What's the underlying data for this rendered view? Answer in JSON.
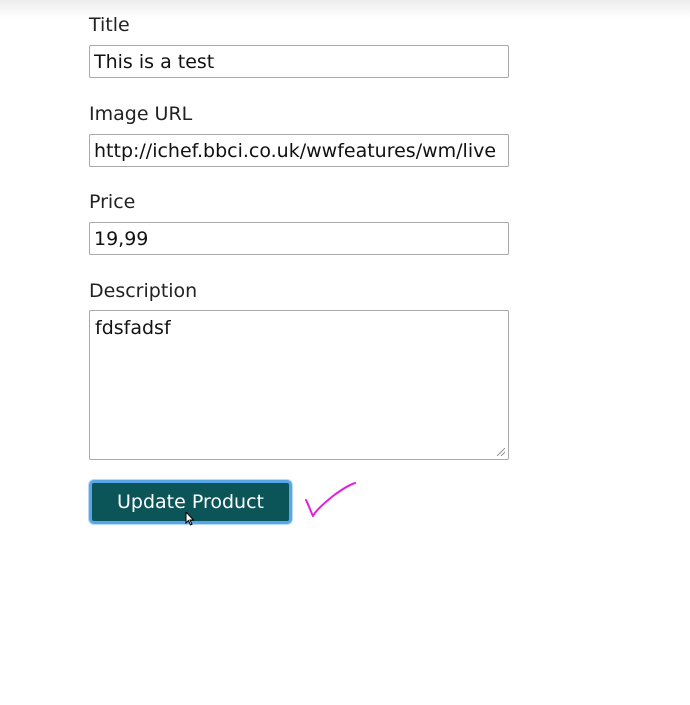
{
  "form": {
    "title_label": "Title",
    "title_value": "This is a test",
    "image_url_label": "Image URL",
    "image_url_value": "http://ichef.bbci.co.uk/wwfeatures/wm/live",
    "price_label": "Price",
    "price_value": "19,99",
    "description_label": "Description",
    "description_value": "fdsfadsf",
    "submit_label": "Update Product"
  },
  "annotation": {
    "checkmark_color": "#e020e0"
  },
  "colors": {
    "button_bg": "#0b5457",
    "button_focus_ring": "#58a6e8"
  }
}
